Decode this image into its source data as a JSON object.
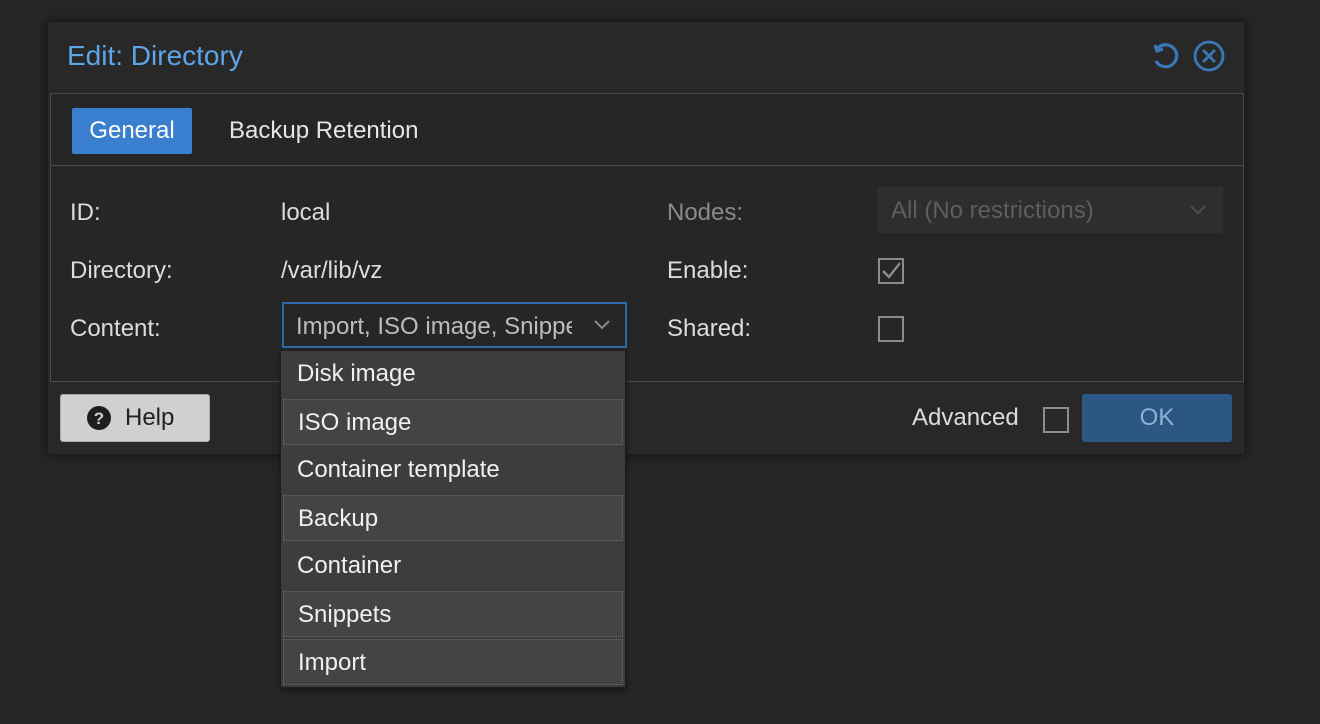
{
  "dialog": {
    "title": "Edit: Directory"
  },
  "tabs": [
    {
      "label": "General",
      "active": true
    },
    {
      "label": "Backup Retention",
      "active": false
    }
  ],
  "form": {
    "id_label": "ID:",
    "id_value": "local",
    "directory_label": "Directory:",
    "directory_value": "/var/lib/vz",
    "content_label": "Content:",
    "content_value": "Import, ISO image, Snippets",
    "nodes_label": "Nodes:",
    "nodes_value": "All (No restrictions)",
    "enable_label": "Enable:",
    "enable_checked": true,
    "shared_label": "Shared:",
    "shared_checked": false
  },
  "footer": {
    "help_label": "Help",
    "advanced_label": "Advanced",
    "advanced_checked": false,
    "ok_label": "OK"
  },
  "dropdown": {
    "options": [
      {
        "label": "Disk image",
        "selected": false
      },
      {
        "label": "ISO image",
        "selected": true
      },
      {
        "label": "Container template",
        "selected": false
      },
      {
        "label": "Backup",
        "selected": true
      },
      {
        "label": "Container",
        "selected": false
      },
      {
        "label": "Snippets",
        "selected": true
      },
      {
        "label": "Import",
        "selected": true
      }
    ]
  },
  "colors": {
    "accent": "#3a7fcf",
    "title": "#5fa4e6",
    "background": "#262626"
  },
  "icons": {
    "reset": "reset-icon",
    "close": "close-circle-icon",
    "help": "question-circle-icon",
    "check": "checkmark-icon",
    "chevron": "chevron-down-icon"
  }
}
